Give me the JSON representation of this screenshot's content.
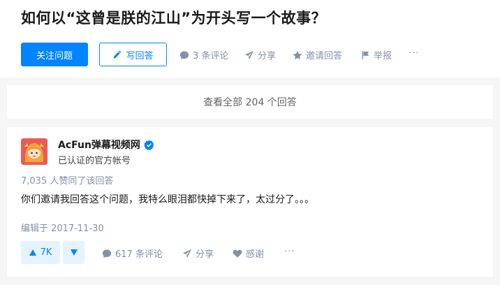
{
  "question": {
    "title": "如何以“这曾是朕的江山”为开头写一个故事？",
    "follow_label": "关注问题",
    "write_label": "写回答",
    "actions": {
      "comments": "3 条评论",
      "share": "分享",
      "invite": "邀请回答",
      "report": "举报",
      "more": "···"
    }
  },
  "view_all": {
    "label": "查看全部 204 个回答"
  },
  "answer": {
    "author": {
      "name": "AcFun弹幕视频网",
      "headline": "已认证的官方帐号"
    },
    "vote_info": "7,035 人赞同了该回答",
    "content": "你们邀请我回答这个问题，我特么眼泪都快掉下来了，太过分了。。。",
    "edit_time": "编辑于 2017-11-30",
    "vote_count": "7K",
    "actions": {
      "comments": "617 条评论",
      "share": "分享",
      "thanks": "感谢",
      "more": "···"
    }
  },
  "colors": {
    "accent": "#0084ff",
    "accent_light": "#e5f2ff",
    "muted": "#8590a6",
    "page_bg": "#f6f6f6"
  },
  "icons": [
    "pencil-icon",
    "comment-icon",
    "share-icon",
    "star-icon",
    "flag-icon",
    "more-icon",
    "verified-icon",
    "triangle-up-icon",
    "triangle-down-icon",
    "heart-icon",
    "acfun-logo"
  ]
}
